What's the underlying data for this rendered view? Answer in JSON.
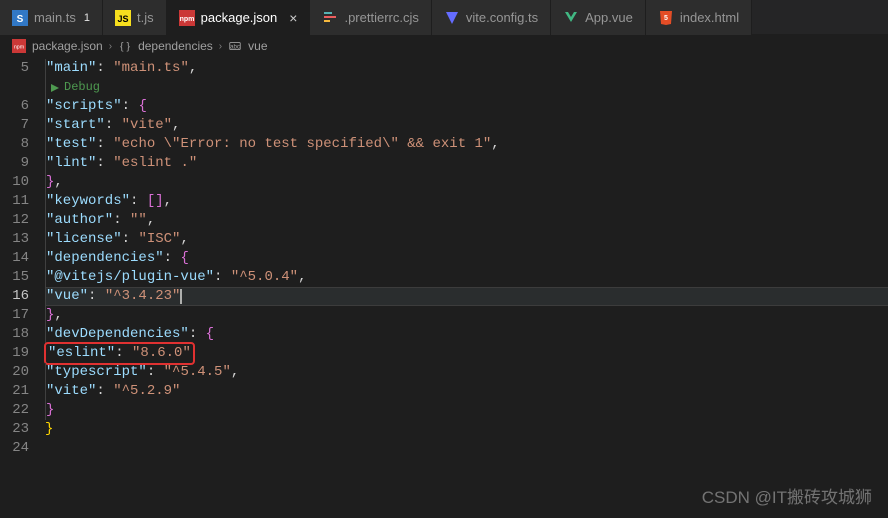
{
  "tabs": [
    {
      "name": "main.ts",
      "icon": "ts",
      "badge": "1"
    },
    {
      "name": "t.js",
      "icon": "js"
    },
    {
      "name": "package.json",
      "icon": "npm",
      "active": true
    },
    {
      "name": ".prettierrc.cjs",
      "icon": "prettier"
    },
    {
      "name": "vite.config.ts",
      "icon": "vite"
    },
    {
      "name": "App.vue",
      "icon": "vue"
    },
    {
      "name": "index.html",
      "icon": "html"
    }
  ],
  "breadcrumbs": {
    "file": "package.json",
    "section": "dependencies",
    "key": "vue"
  },
  "debugLens": "Debug",
  "lineNumbers": [
    "5",
    "",
    "6",
    "7",
    "8",
    "9",
    "10",
    "11",
    "12",
    "13",
    "14",
    "15",
    "16",
    "17",
    "18",
    "19",
    "20",
    "21",
    "22",
    "23",
    "24"
  ],
  "currentLine": 16,
  "code": {
    "main": {
      "k": "\"main\"",
      "v": "\"main.ts\""
    },
    "scripts": {
      "k": "\"scripts\"",
      "start": {
        "k": "\"start\"",
        "v": "\"vite\""
      },
      "test": {
        "k": "\"test\"",
        "v": "\"echo \\\"Error: no test specified\\\" && exit 1\""
      },
      "lint": {
        "k": "\"lint\"",
        "v": "\"eslint .\""
      }
    },
    "keywords": {
      "k": "\"keywords\""
    },
    "author": {
      "k": "\"author\"",
      "v": "\"\""
    },
    "license": {
      "k": "\"license\"",
      "v": "\"ISC\""
    },
    "dependencies": {
      "k": "\"dependencies\"",
      "pluginVue": {
        "k": "\"@vitejs/plugin-vue\"",
        "v": "\"^5.0.4\""
      },
      "vue": {
        "k": "\"vue\"",
        "v": "\"^3.4.23\""
      }
    },
    "devDependencies": {
      "k": "\"devDependencies\"",
      "eslint": {
        "k": "\"eslint\"",
        "v": "\"8.6.0\""
      },
      "typescript": {
        "k": "\"typescript\"",
        "v": "\"^5.4.5\""
      },
      "vite": {
        "k": "\"vite\"",
        "v": "\"^5.2.9\""
      }
    }
  },
  "watermark": "CSDN @IT搬砖攻城狮"
}
